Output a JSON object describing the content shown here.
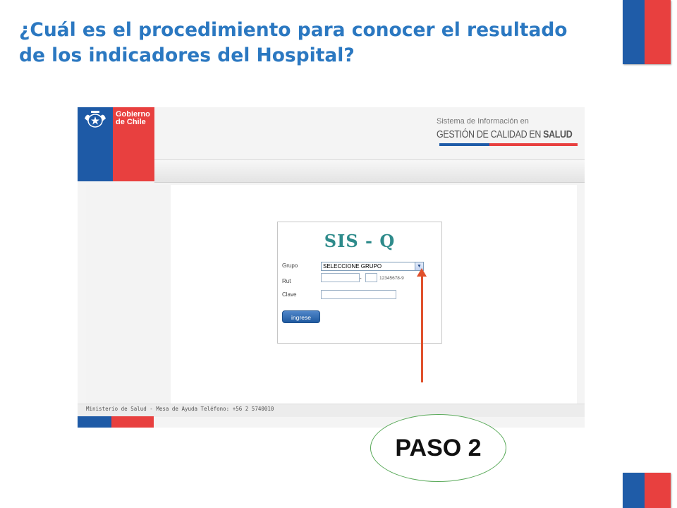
{
  "slide": {
    "title": "¿Cuál es el procedimiento para  conocer el resultado de los indicadores del Hospital?"
  },
  "colors": {
    "title_blue": "#2b78c1",
    "flag_blue": "#1f5ca8",
    "flag_red": "#e8403f",
    "arrow": "#e0512c",
    "ellipse_border": "#5aaa5a"
  },
  "screenshot": {
    "logo": {
      "line1": "Gobierno",
      "line2": "de Chile"
    },
    "header": {
      "line1": "Sistema de Información en",
      "line2_normal": "GESTIÓN DE CALIDAD EN ",
      "line2_bold": "SALUD"
    },
    "login": {
      "title": "SIS - Q",
      "grupo_label": "Grupo",
      "grupo_value": "SELECCIONE GRUPO",
      "rut_label": "Rut",
      "rut_dash": "-",
      "rut_hint": "12345678-9",
      "clave_label": "Clave",
      "button_label": "ingrese"
    },
    "footer": "Ministerio de Salud - Mesa de Ayuda Teléfono: +56 2 5740010"
  },
  "callout": {
    "label": "PASO 2"
  }
}
